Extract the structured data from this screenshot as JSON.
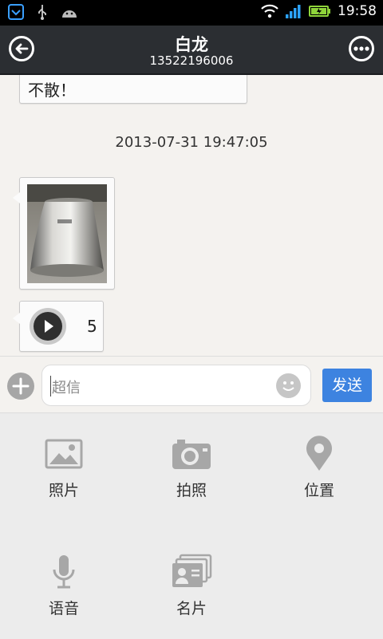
{
  "status_bar": {
    "time": "19:58"
  },
  "header": {
    "title": "白龙",
    "subtitle": "13522196006"
  },
  "messages": {
    "text_message": "不散！",
    "timestamp": "2013-07-31 19:47:05",
    "voice_duration": "5"
  },
  "input_bar": {
    "placeholder": "超信",
    "send_label": "发送"
  },
  "panel": {
    "items": [
      {
        "label": "照片",
        "icon": "photo-icon"
      },
      {
        "label": "拍照",
        "icon": "camera-icon"
      },
      {
        "label": "位置",
        "icon": "location-icon"
      },
      {
        "label": "语音",
        "icon": "microphone-icon"
      },
      {
        "label": "名片",
        "icon": "contact-card-icon"
      }
    ]
  },
  "colors": {
    "accent": "#3d83e0",
    "header_bg": "#2b2e32",
    "icon_gray": "#a7a7a7"
  }
}
